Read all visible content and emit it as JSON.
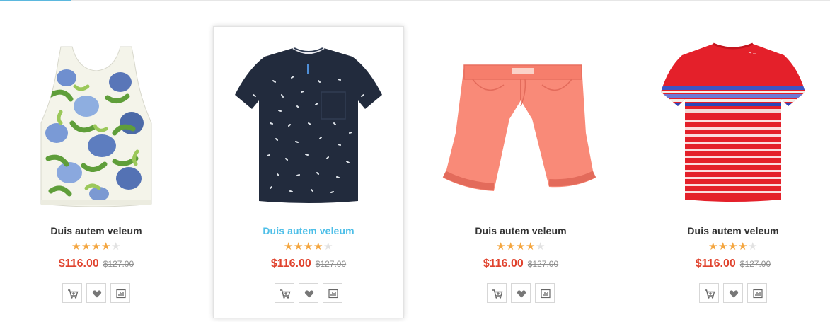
{
  "products": [
    {
      "name": "Duis autem veleum",
      "rating": 4,
      "max_rating": 5,
      "price": "$116.00",
      "old_price": "$127.00",
      "image": "sleeveless-floral-top",
      "actions": [
        "cart-icon",
        "heart-icon",
        "compare-icon"
      ]
    },
    {
      "name": "Duis autem veleum",
      "rating": 4,
      "max_rating": 5,
      "price": "$116.00",
      "old_price": "$127.00",
      "image": "navy-print-tshirt",
      "active": true,
      "actions": [
        "cart-icon",
        "heart-icon",
        "compare-icon"
      ]
    },
    {
      "name": "Duis autem veleum",
      "rating": 4,
      "max_rating": 5,
      "price": "$116.00",
      "old_price": "$127.00",
      "image": "coral-chino-shorts",
      "actions": [
        "cart-icon",
        "heart-icon",
        "compare-icon"
      ]
    },
    {
      "name": "Duis autem veleum",
      "rating": 4,
      "max_rating": 5,
      "price": "$116.00",
      "old_price": "$127.00",
      "image": "red-striped-tshirt",
      "actions": [
        "cart-icon",
        "heart-icon",
        "compare-icon"
      ]
    }
  ],
  "colors": {
    "accent": "#4ebfe8",
    "price": "#e0432e",
    "star": "#f4a640",
    "star_empty": "#e2e2e2"
  }
}
